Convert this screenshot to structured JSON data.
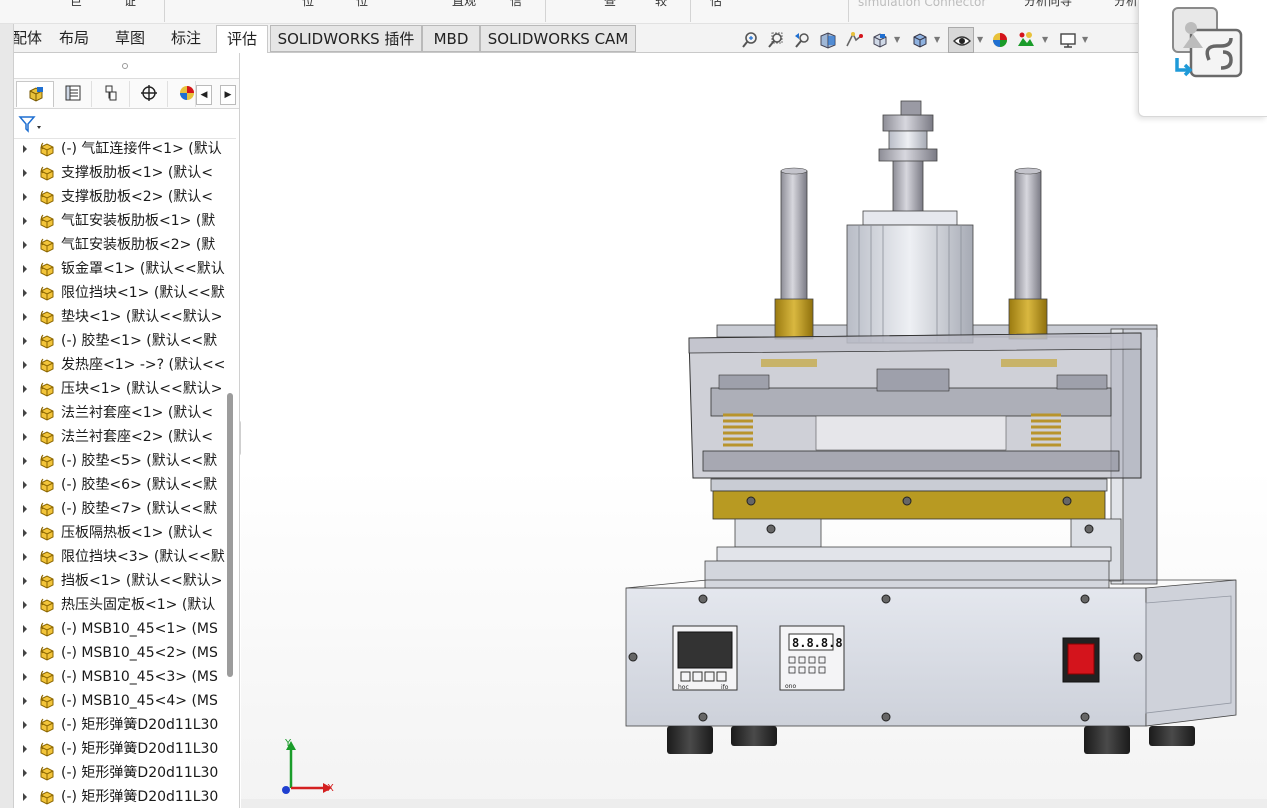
{
  "ribbon_top": {
    "fragments": [
      "巨",
      "证",
      "位",
      "位",
      "直观",
      "信",
      "查",
      "较",
      "估",
      "simulation Connector",
      "分析向导",
      "分析"
    ]
  },
  "command_manager": {
    "tabs": [
      {
        "label": "配体",
        "state": "normal"
      },
      {
        "label": "布局",
        "state": "normal"
      },
      {
        "label": "草图",
        "state": "normal"
      },
      {
        "label": "标注",
        "state": "normal"
      },
      {
        "label": "评估",
        "state": "active"
      },
      {
        "label": "SOLIDWORKS 插件",
        "state": "boxed"
      },
      {
        "label": "MBD",
        "state": "boxed"
      },
      {
        "label": "SOLIDWORKS CAM",
        "state": "boxed"
      }
    ]
  },
  "view_toolbar": {
    "icons": [
      "zoom-to-fit-icon",
      "zoom-to-area-icon",
      "previous-view-icon",
      "section-view-icon",
      "dynamic-annotation-icon",
      "view-orientation-icon",
      "display-style-icon",
      "hide-show-items-icon",
      "edit-appearance-icon",
      "apply-scene-icon",
      "view-settings-icon"
    ]
  },
  "feature_manager": {
    "tabs": [
      "feature-tree-icon",
      "property-manager-icon",
      "configuration-manager-icon",
      "dimxpert-icon",
      "display-manager-icon"
    ],
    "scroll_left": "◀",
    "scroll_right": "▶",
    "filter_icon": "filter-icon",
    "tree_items": [
      "(-) 气缸连接件<1> (默认",
      "支撑板肋板<1> (默认<",
      "支撑板肋板<2> (默认<",
      "气缸安装板肋板<1> (默",
      "气缸安装板肋板<2> (默",
      "钣金罩<1> (默认<<默认",
      "限位挡块<1> (默认<<默",
      "垫块<1> (默认<<默认>",
      "(-) 胶垫<1> (默认<<默",
      "发热座<1> ->? (默认<<",
      "压块<1> (默认<<默认>",
      "法兰衬套座<1> (默认<",
      "法兰衬套座<2> (默认<",
      "(-) 胶垫<5> (默认<<默",
      "(-) 胶垫<6> (默认<<默",
      "(-) 胶垫<7> (默认<<默",
      "压板隔热板<1> (默认<",
      "限位挡块<3> (默认<<默",
      "挡板<1> (默认<<默认>",
      "热压头固定板<1> (默认",
      "(-) MSB10_45<1> (MS",
      "(-) MSB10_45<2> (MS",
      "(-) MSB10_45<3> (MS",
      "(-) MSB10_45<4> (MS",
      "(-) 矩形弹簧D20d11L30",
      "(-) 矩形弹簧D20d11L30",
      "(-) 矩形弹簧D20d11L30",
      "(-) 矩形弹簧D20d11L30"
    ]
  },
  "model": {
    "temp_display": "8.8.8.8",
    "brand_left": "hoc",
    "brand_right": "ifo",
    "timer_brand": "ono"
  },
  "triad": {
    "x_label": "X",
    "y_label": "Y"
  },
  "colors": {
    "accent_blue": "#1f6fd1",
    "part_yellow": "#e8c13a",
    "brass": "#b8961f",
    "switch_red": "#d4141c",
    "axis_x": "#d42020",
    "axis_y": "#1a9c2a",
    "axis_z": "#2040d0"
  }
}
